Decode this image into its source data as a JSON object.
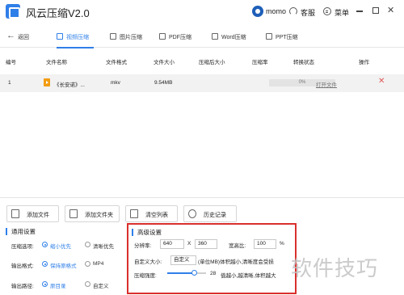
{
  "app": {
    "title": "风云压缩V2.0",
    "user": "momo",
    "support": "客服",
    "menu": "菜单"
  },
  "nav": {
    "back": "返回",
    "tabs": [
      {
        "label": "视频压缩",
        "active": true
      },
      {
        "label": "图片压缩",
        "active": false
      },
      {
        "label": "PDF压缩",
        "active": false
      },
      {
        "label": "Word压缩",
        "active": false
      },
      {
        "label": "PPT压缩",
        "active": false
      }
    ]
  },
  "table": {
    "headers": [
      "编号",
      "文件名称",
      "文件格式",
      "文件大小",
      "压缩后大小",
      "压缩率",
      "转换状态",
      "操作"
    ],
    "rows": [
      {
        "index": "1",
        "name": "《长安诺》...",
        "format": "mkv",
        "size": "9.54MB",
        "compressed_size": "",
        "ratio": "",
        "progress_text": "0%",
        "progress": 0,
        "action": "打开文件"
      }
    ]
  },
  "toolbar": {
    "add_file": "添加文件",
    "add_folder": "添加文件夹",
    "clear_list": "清空列表",
    "history": "历史记录"
  },
  "general": {
    "title": "通用设置",
    "compress_option_label": "压缩选项:",
    "compress_options": [
      "缩小优先",
      "清晰优先"
    ],
    "compress_selected": "缩小优先",
    "output_format_label": "输出格式:",
    "output_formats": [
      "保持原格式",
      "MP4"
    ],
    "output_format_selected": "保持原格式",
    "output_path_label": "输出路径:",
    "output_paths": [
      "原目录",
      "自定义"
    ],
    "output_path_selected": "原目录"
  },
  "advanced": {
    "title": "高级设置",
    "resolution_label": "分辨率:",
    "width": "640",
    "x_sep": "X",
    "height": "360",
    "aspect_label": "宽高比:",
    "aspect_value": "100",
    "percent": "%",
    "custom_size_label": "自定义大小:",
    "custom_size_value": "自定义",
    "custom_size_hint": "(单位MB)体积越小,清晰度会受损",
    "strength_label": "压缩强度:",
    "strength_value": "28",
    "strength_level": 0.7,
    "strength_hint": "值越小,越清晰,体积越大"
  },
  "watermark": "软件技巧",
  "colors": {
    "accent": "#2f7fe8",
    "highlight_border": "#d9302c",
    "delete": "#e05555"
  },
  "icons": [
    "app-logo-icon",
    "back-arrow-icon",
    "headset-icon",
    "menu-icon",
    "video-file-icon",
    "delete-icon"
  ]
}
